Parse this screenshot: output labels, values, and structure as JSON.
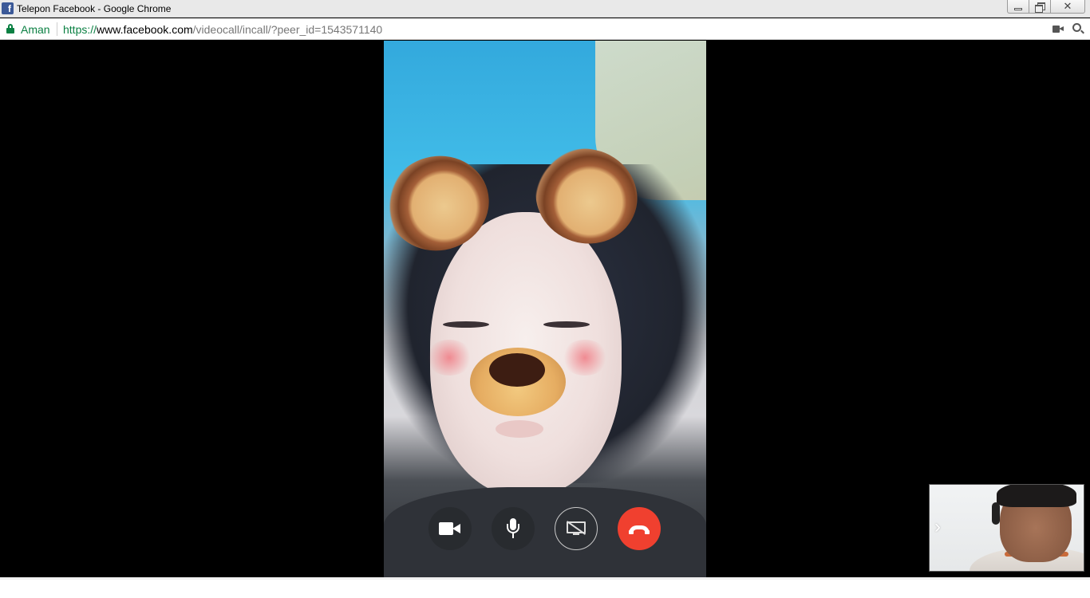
{
  "window": {
    "title": "Telepon Facebook - Google Chrome",
    "favicon": "facebook-icon",
    "controls": {
      "minimize_icon": "minimize-icon",
      "restore_icon": "restore-icon",
      "close_icon": "close-icon"
    }
  },
  "address_bar": {
    "secure_label": "Aman",
    "url_scheme": "https://",
    "url_host": "www.facebook.com",
    "url_path": "/videocall/incall/?peer_id=1543571140",
    "icons": [
      "camera-icon",
      "zoom-icon"
    ]
  },
  "call": {
    "remote_video": "remote-participant-video",
    "self_preview": "self-preview-video",
    "controls": [
      {
        "name": "video-toggle",
        "icon": "video-camera-icon"
      },
      {
        "name": "mic-toggle",
        "icon": "microphone-icon"
      },
      {
        "name": "screen-share",
        "icon": "screen-share-off-icon"
      },
      {
        "name": "end-call",
        "icon": "hang-up-icon"
      }
    ],
    "colors": {
      "end_call": "#f0402f",
      "secure_green": "#0b8043",
      "facebook_blue": "#3b5998"
    }
  }
}
